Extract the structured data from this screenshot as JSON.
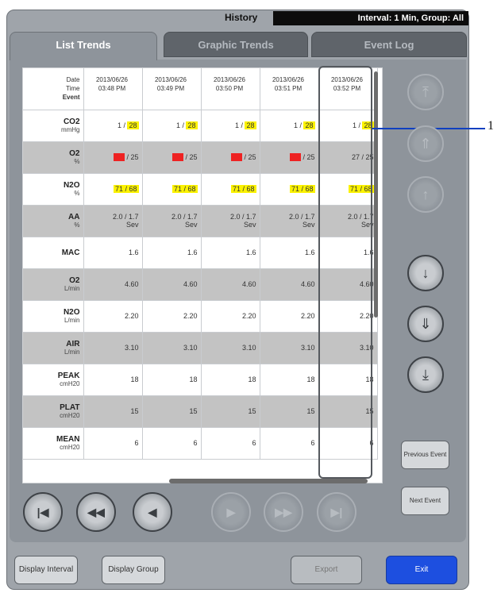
{
  "header": {
    "title": "History",
    "interval_text": "Interval: 1 Min, Group: All"
  },
  "tabs": [
    {
      "label": "List Trends",
      "active": true
    },
    {
      "label": "Graphic Trends",
      "active": false
    },
    {
      "label": "Event Log",
      "active": false
    }
  ],
  "table": {
    "header_label": [
      "Date",
      "Time",
      "Event"
    ],
    "columns": [
      {
        "date": "2013/06/26",
        "time": "03:48 PM"
      },
      {
        "date": "2013/06/26",
        "time": "03:49 PM"
      },
      {
        "date": "2013/06/26",
        "time": "03:50 PM"
      },
      {
        "date": "2013/06/26",
        "time": "03:51 PM"
      },
      {
        "date": "2013/06/26",
        "time": "03:52 PM"
      }
    ],
    "rows": [
      {
        "name": "CO2",
        "unit": "mmHg",
        "cells": [
          {
            "a": "1 /",
            "b": "28"
          },
          {
            "a": "1 /",
            "b": "28"
          },
          {
            "a": "1 /",
            "b": "28"
          },
          {
            "a": "1 /",
            "b": "28"
          },
          {
            "a": "1 /",
            "b": "28"
          }
        ]
      },
      {
        "name": "O2",
        "unit": "%",
        "cells": [
          {
            "a": "27",
            "b": "/ 25"
          },
          {
            "a": "27",
            "b": "/ 25"
          },
          {
            "a": "27",
            "b": "/ 25"
          },
          {
            "a": "27",
            "b": "/ 25"
          },
          {
            "a": "27 / 25",
            "b": ""
          }
        ]
      },
      {
        "name": "N2O",
        "unit": "%",
        "cells": [
          {
            "a": "71 / 68"
          },
          {
            "a": "71 / 68"
          },
          {
            "a": "71 / 68"
          },
          {
            "a": "71 / 68"
          },
          {
            "a": "71 / 68"
          }
        ]
      },
      {
        "name": "AA",
        "unit": "%",
        "cells": [
          {
            "a": "2.0 / 1.7",
            "b": "Sev"
          },
          {
            "a": "2.0 / 1.7",
            "b": "Sev"
          },
          {
            "a": "2.0 / 1.7",
            "b": "Sev"
          },
          {
            "a": "2.0 / 1.7",
            "b": "Sev"
          },
          {
            "a": "2.0 / 1.7",
            "b": "Sev"
          }
        ]
      },
      {
        "name": "MAC",
        "unit": "",
        "cells": [
          {
            "a": "1.6"
          },
          {
            "a": "1.6"
          },
          {
            "a": "1.6"
          },
          {
            "a": "1.6"
          },
          {
            "a": "1.6"
          }
        ]
      },
      {
        "name": "O2",
        "unit": "L/min",
        "cells": [
          {
            "a": "4.60"
          },
          {
            "a": "4.60"
          },
          {
            "a": "4.60"
          },
          {
            "a": "4.60"
          },
          {
            "a": "4.60"
          }
        ]
      },
      {
        "name": "N2O",
        "unit": "L/min",
        "cells": [
          {
            "a": "2.20"
          },
          {
            "a": "2.20"
          },
          {
            "a": "2.20"
          },
          {
            "a": "2.20"
          },
          {
            "a": "2.20"
          }
        ]
      },
      {
        "name": "AIR",
        "unit": "L/min",
        "cells": [
          {
            "a": "3.10"
          },
          {
            "a": "3.10"
          },
          {
            "a": "3.10"
          },
          {
            "a": "3.10"
          },
          {
            "a": "3.10"
          }
        ]
      },
      {
        "name": "PEAK",
        "unit": "cmH20",
        "cells": [
          {
            "a": "18"
          },
          {
            "a": "18"
          },
          {
            "a": "18"
          },
          {
            "a": "18"
          },
          {
            "a": "18"
          }
        ]
      },
      {
        "name": "PLAT",
        "unit": "cmH20",
        "cells": [
          {
            "a": "15"
          },
          {
            "a": "15"
          },
          {
            "a": "15"
          },
          {
            "a": "15"
          },
          {
            "a": "15"
          }
        ]
      },
      {
        "name": "MEAN",
        "unit": "cmH20",
        "cells": [
          {
            "a": "6"
          },
          {
            "a": "6"
          },
          {
            "a": "6"
          },
          {
            "a": "6"
          },
          {
            "a": "6"
          }
        ]
      }
    ]
  },
  "side_buttons": {
    "previous_event": "Previous Event",
    "next_event": "Next Event"
  },
  "footer": {
    "display_interval": "Display Interval",
    "display_group": "Display Group",
    "export": "Export",
    "exit": "Exit"
  },
  "callout": "1",
  "colors": {
    "highlight_yellow": "#fbf200",
    "alarm_red": "#ee2222",
    "exit_blue": "#1d4fe0"
  }
}
